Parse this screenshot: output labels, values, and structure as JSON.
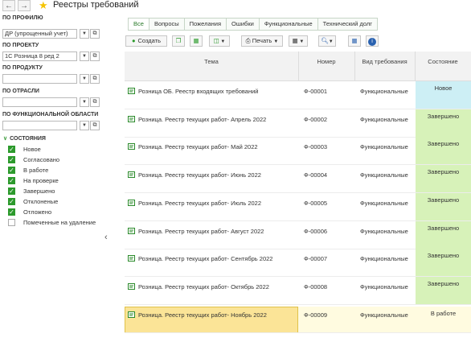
{
  "window": {
    "title": "Реестры требований",
    "back_icon": "arrow-left-icon",
    "forward_icon": "arrow-right-icon",
    "favorite_icon": "star-icon"
  },
  "filters": {
    "profile": {
      "label": "ПО ПРОФИЛЮ",
      "value": "ДР (упрощенный учет)"
    },
    "project": {
      "label": "ПО ПРОЕКТУ",
      "value": "1С Розница 8 ред 2"
    },
    "product": {
      "label": "ПО ПРОДУКТУ",
      "value": ""
    },
    "industry": {
      "label": "ПО ОТРАСЛИ",
      "value": ""
    },
    "functional_area": {
      "label": "ПО ФУНКЦИОНАЛЬНОЙ ОБЛАСТИ",
      "value": ""
    },
    "states": {
      "label": "СОСТОЯНИЯ",
      "items": [
        {
          "label": "Новое",
          "checked": true
        },
        {
          "label": "Согласовано",
          "checked": true
        },
        {
          "label": "В работе",
          "checked": true
        },
        {
          "label": "На проверке",
          "checked": true
        },
        {
          "label": "Завершено",
          "checked": true
        },
        {
          "label": "Отклоненые",
          "checked": true
        },
        {
          "label": "Отложено",
          "checked": true
        },
        {
          "label": "Помеченные на удаление",
          "checked": false
        }
      ]
    }
  },
  "tabs": [
    {
      "label": "Все",
      "active": true
    },
    {
      "label": "Вопросы",
      "active": false
    },
    {
      "label": "Пожелания",
      "active": false
    },
    {
      "label": "Ошибки",
      "active": false
    },
    {
      "label": "Функциональные",
      "active": false
    },
    {
      "label": "Технический долг",
      "active": false
    }
  ],
  "toolbar": {
    "create_label": "Создать",
    "print_label": "Печать"
  },
  "table": {
    "columns": [
      "Тема",
      "Номер",
      "Вид требования",
      "Состояние"
    ],
    "rows": [
      {
        "topic": "Розница ОБ. Реестр входящих требований",
        "number": "Ф-00001",
        "kind": "Функциональные",
        "state": "Новое"
      },
      {
        "topic": "Розница. Реестр текущих работ- Апрель 2022",
        "number": "Ф-00002",
        "kind": "Функциональные",
        "state": "Завершено"
      },
      {
        "topic": "Розница. Реестр текущих работ- Май 2022",
        "number": "Ф-00003",
        "kind": "Функциональные",
        "state": "Завершено"
      },
      {
        "topic": "Розница. Реестр текущих работ- Июнь 2022",
        "number": "Ф-00004",
        "kind": "Функциональные",
        "state": "Завершено"
      },
      {
        "topic": "Розница. Реестр текущих работ- Июль 2022",
        "number": "Ф-00005",
        "kind": "Функциональные",
        "state": "Завершено"
      },
      {
        "topic": "Розница. Реестр текущих работ- Август 2022",
        "number": "Ф-00006",
        "kind": "Функциональные",
        "state": "Завершено"
      },
      {
        "topic": "Розница. Реестр текущих работ- Сентябрь 2022",
        "number": "Ф-00007",
        "kind": "Функциональные",
        "state": "Завершено"
      },
      {
        "topic": "Розница. Реестр текущих работ- Октябрь 2022",
        "number": "Ф-00008",
        "kind": "Функциональные",
        "state": "Завершено"
      },
      {
        "topic": "Розница. Реестр текущих работ- Ноябрь 2022",
        "number": "Ф-00009",
        "kind": "Функциональные",
        "state": "В работе"
      }
    ]
  },
  "colors": {
    "state_new": "#cdeff5",
    "state_done": "#d7f2b9",
    "state_in_work": "#fffbe0",
    "selected": "#fbe497",
    "accent": "#2c9a2c"
  }
}
